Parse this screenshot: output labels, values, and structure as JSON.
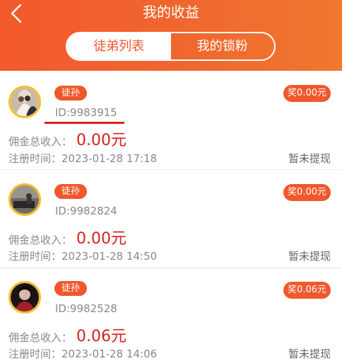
{
  "header": {
    "title": "我的收益",
    "tabs": [
      {
        "label": "徒弟列表",
        "active": true
      },
      {
        "label": "我的锁粉",
        "active": false
      }
    ]
  },
  "colors": {
    "accent": "#f0582c",
    "amount": "#d61f1f",
    "avatar_ring": "#f1c12c"
  },
  "members": [
    {
      "relation": "徒孙",
      "id": "ID:9983915",
      "reward": "奖0.00元",
      "income_label": "佣金总收入：",
      "income_value": "0.00元",
      "reg_label": "注册时间：",
      "reg_time": "2023-01-28 17:18",
      "status": "暂未提现"
    },
    {
      "relation": "徒孙",
      "id": "ID:9982824",
      "reward": "奖0.00元",
      "income_label": "佣金总收入：",
      "income_value": "0.00元",
      "reg_label": "注册时间：",
      "reg_time": "2023-01-28 14:50",
      "status": "暂未提现"
    },
    {
      "relation": "徒孙",
      "id": "ID:9982528",
      "reward": "奖0.06元",
      "income_label": "佣金总收入：",
      "income_value": "0.06元",
      "reg_label": "注册时间：",
      "reg_time": "2023-01-28 14:06",
      "status": "暂未提现"
    }
  ]
}
